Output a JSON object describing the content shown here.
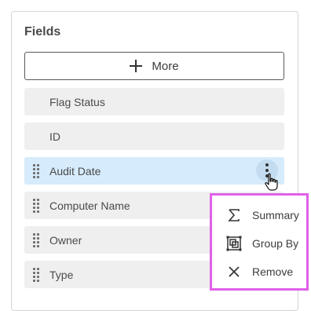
{
  "panel": {
    "title": "Fields",
    "more_label": "More"
  },
  "fields": [
    {
      "label": "Flag Status",
      "draggable": false
    },
    {
      "label": "ID",
      "draggable": false
    },
    {
      "label": "Audit Date",
      "draggable": true,
      "selected": true
    },
    {
      "label": "Computer Name",
      "draggable": true
    },
    {
      "label": "Owner",
      "draggable": true
    },
    {
      "label": "Type",
      "draggable": true
    }
  ],
  "context_menu": {
    "items": [
      {
        "label": "Summary",
        "icon": "sigma-icon"
      },
      {
        "label": "Group By",
        "icon": "group-by-icon"
      },
      {
        "label": "Remove",
        "icon": "close-icon"
      }
    ]
  },
  "colors": {
    "selected_row": "#d6ebfb",
    "row": "#efefef",
    "menu_highlight_border": "#e060e8"
  }
}
